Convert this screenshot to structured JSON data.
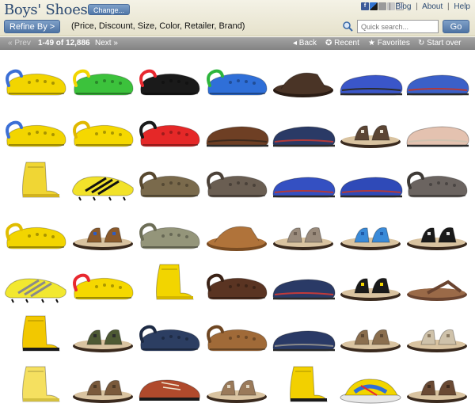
{
  "header": {
    "title": "Boys' Shoes",
    "change_label": "Change...",
    "links": [
      "Blog",
      "About",
      "Help"
    ],
    "link_separator": "|",
    "refine_label": "Refine By >",
    "refine_options": "(Price, Discount, Size, Color, Retailer, Brand)",
    "search_placeholder": "Quick search...",
    "go_label": "Go"
  },
  "nav": {
    "prev_label": "« Prev",
    "results_count": "1-49 of 12,886",
    "next_label": "Next »",
    "back_label": "◂ Back",
    "recent_label": "✪ Recent",
    "favorites_label": "★ Favorites",
    "start_over_label": "↻ Start over"
  },
  "shoes": [
    {
      "type": "clog",
      "color": "#f2d500",
      "accent": "#3b6fd6"
    },
    {
      "type": "clog",
      "color": "#3cc23c",
      "accent": "#f2d500"
    },
    {
      "type": "clog",
      "color": "#1a1a1a",
      "accent": "#e8282f"
    },
    {
      "type": "clog",
      "color": "#2f6fd8",
      "accent": "#2db53c"
    },
    {
      "type": "slide",
      "color": "#4a3426",
      "accent": "#2a1c14"
    },
    {
      "type": "slipper",
      "color": "#3a56c9",
      "accent": "#2c2c2c"
    },
    {
      "type": "slipper",
      "color": "#3b60c8",
      "accent": "#b23a3a"
    },
    {
      "type": "clog",
      "color": "#f2d500",
      "accent": "#3b6fd6"
    },
    {
      "type": "clog",
      "color": "#f5d800",
      "accent": "#e0b800"
    },
    {
      "type": "clog",
      "color": "#e52828",
      "accent": "#1a1a1a"
    },
    {
      "type": "slipper",
      "color": "#6e3f24",
      "accent": "#3e2a1d"
    },
    {
      "type": "slipper",
      "color": "#2a3a66",
      "accent": "#b23a3a"
    },
    {
      "type": "strap-sandal",
      "color": "#5b4534",
      "accent": "#e6e0d2"
    },
    {
      "type": "slipper",
      "color": "#e4c2b0",
      "accent": "#cfc2b0"
    },
    {
      "type": "boot",
      "color": "#f0d634",
      "accent": "#d1b21e"
    },
    {
      "type": "cleat",
      "color": "#f2e22a",
      "accent": "#111111"
    },
    {
      "type": "clog",
      "color": "#7a6a4c",
      "accent": "#57482f"
    },
    {
      "type": "clog",
      "color": "#6a5e52",
      "accent": "#4b4138"
    },
    {
      "type": "slipper",
      "color": "#3450c2",
      "accent": "#b23a3a"
    },
    {
      "type": "slipper",
      "color": "#2f4ab8",
      "accent": "#b23a3a"
    },
    {
      "type": "clog",
      "color": "#6b6460",
      "accent": "#3e3a36"
    },
    {
      "type": "clog",
      "color": "#f2d500",
      "accent": "#e0bd00"
    },
    {
      "type": "strap-sandal",
      "color": "#8a5a2c",
      "accent": "#2f5cc0"
    },
    {
      "type": "clog",
      "color": "#94957a",
      "accent": "#6d6e57"
    },
    {
      "type": "slide",
      "color": "#b0733a",
      "accent": "#7a4c22"
    },
    {
      "type": "strap-sandal",
      "color": "#9a8b7c",
      "accent": "#6e6054"
    },
    {
      "type": "strap-sandal",
      "color": "#3a8ad8",
      "accent": "#1f5aa8"
    },
    {
      "type": "strap-sandal",
      "color": "#1a1a1a",
      "accent": "#e0e0e0"
    },
    {
      "type": "cleat",
      "color": "#f2e830",
      "accent": "#8a8a8a"
    },
    {
      "type": "clog",
      "color": "#f5d800",
      "accent": "#e8282f"
    },
    {
      "type": "boot",
      "color": "#f2d500",
      "accent": "#d4b600"
    },
    {
      "type": "clog",
      "color": "#5a3422",
      "accent": "#3a2216"
    },
    {
      "type": "slipper",
      "color": "#2a3a66",
      "accent": "#c23a3a"
    },
    {
      "type": "strap-sandal",
      "color": "#1a1a1a",
      "accent": "#f2d500"
    },
    {
      "type": "flip-flop",
      "color": "#9a6a48",
      "accent": "#6a4430"
    },
    {
      "type": "boot",
      "color": "#f2c800",
      "accent": "#1a1a1a"
    },
    {
      "type": "strap-sandal",
      "color": "#4e5a34",
      "accent": "#2c2c2c"
    },
    {
      "type": "clog",
      "color": "#2c3e62",
      "accent": "#1d2a44"
    },
    {
      "type": "clog",
      "color": "#a06a38",
      "accent": "#6e4622"
    },
    {
      "type": "slipper",
      "color": "#2a3a66",
      "accent": "#8a8a8a"
    },
    {
      "type": "strap-sandal",
      "color": "#8a6e4e",
      "accent": "#5a4632"
    },
    {
      "type": "strap-sandal",
      "color": "#cfc2aa",
      "accent": "#8a7a62"
    },
    {
      "type": "boot",
      "color": "#f5e060",
      "accent": "#d4c040"
    },
    {
      "type": "strap-sandal",
      "color": "#7a5a3c",
      "accent": "#4e3a26"
    },
    {
      "type": "sneaker",
      "color": "#b04a2c",
      "accent": "#1a1a1a"
    },
    {
      "type": "strap-sandal",
      "color": "#9a7a5a",
      "accent": "#e0d6c2"
    },
    {
      "type": "boot",
      "color": "#f2d000",
      "accent": "#1a1a1a"
    },
    {
      "type": "sport-sandal",
      "color": "#f2d500",
      "accent": "#2f6fd8"
    },
    {
      "type": "strap-sandal",
      "color": "#6a4a34",
      "accent": "#3e2a1d"
    }
  ]
}
